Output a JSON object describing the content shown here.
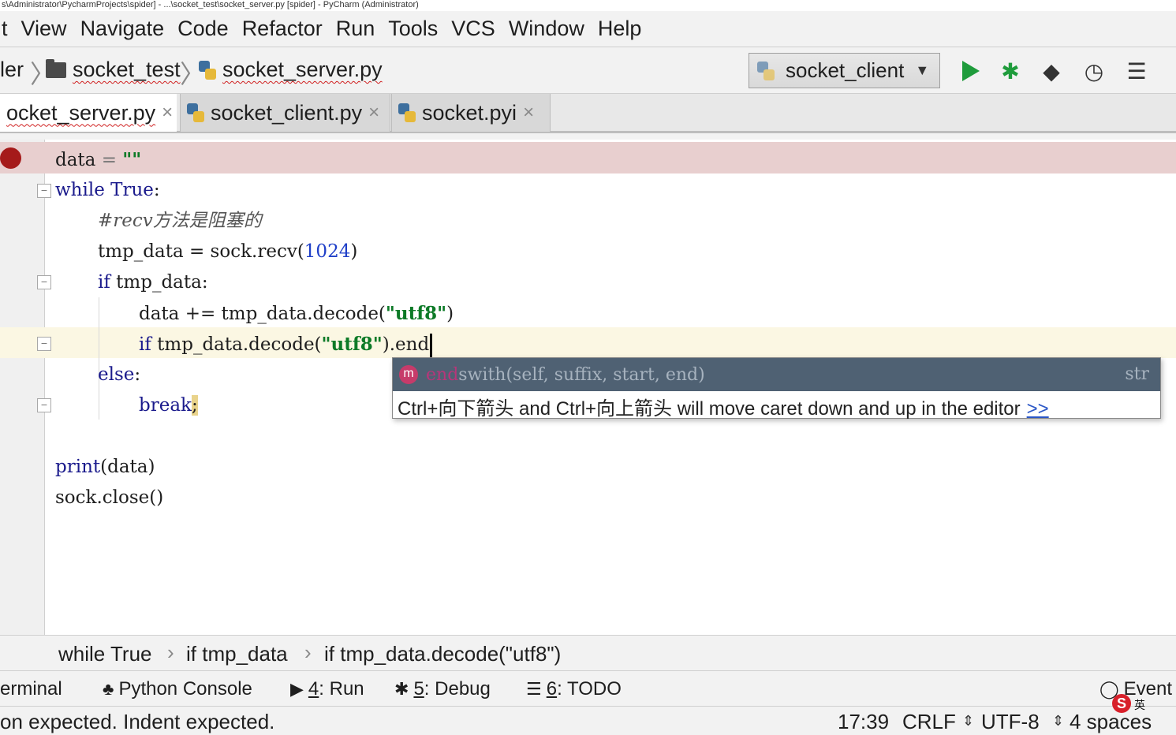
{
  "window": {
    "title": "s\\Administrator\\PycharmProjects\\spider] - ...\\socket_test\\socket_server.py [spider] - PyCharm (Administrator)"
  },
  "menu": [
    "t",
    "View",
    "Navigate",
    "Code",
    "Refactor",
    "Run",
    "Tools",
    "VCS",
    "Window",
    "Help"
  ],
  "nav": {
    "root": "ler",
    "folder": "socket_test",
    "file": "socket_server.py",
    "run_config": "socket_client"
  },
  "tabs": [
    {
      "label": "ocket_server.py",
      "active": true
    },
    {
      "label": "socket_client.py",
      "active": false
    },
    {
      "label": "socket.pyi",
      "active": false
    }
  ],
  "code": {
    "l1_a": "data",
    "l1_op": " = ",
    "l1_str": "\"\"",
    "l2_kw": "while",
    "l2_kw2": "True",
    "l2_c": ":",
    "l3": "#recv方法是阻塞的",
    "l4_a": "tmp_data = sock.recv(",
    "l4_num": "1024",
    "l4_b": ")",
    "l5_kw": "if",
    "l5_b": " tmp_data:",
    "l6_a": "data += tmp_data.decode(",
    "l6_str": "\"utf8\"",
    "l6_b": ")",
    "l7_kw": "if",
    "l7_a": " tmp_data.decode(",
    "l7_str": "\"utf8\"",
    "l7_b": ").end",
    "l8_kw": "else",
    "l8_c": ":",
    "l9_kw": "break",
    "l9_semi": ";",
    "l10_fn": "print",
    "l10_b": "(data)",
    "l11": "sock.close()"
  },
  "completion": {
    "icon_letter": "m",
    "match": "end",
    "rest": "swith(self, suffix, start, end)",
    "type": "str",
    "hint": "Ctrl+向下箭头 and Ctrl+向上箭头 will move caret down and up in the editor",
    "hint_link": ">>"
  },
  "code_breadcrumbs": [
    "while True",
    "if tmp_data",
    "if tmp_data.decode(\"utf8\")"
  ],
  "tool_windows": {
    "terminal": "erminal",
    "python_console": "Python Console",
    "run_num": "4",
    "run_label": ": Run",
    "debug_num": "5",
    "debug_label": ": Debug",
    "todo_num": "6",
    "todo_label": ": TODO",
    "event": "Event"
  },
  "status": {
    "message": "on expected. Indent expected.",
    "position": "17:39",
    "line_sep": "CRLF",
    "encoding": "UTF-8",
    "indent": "4 spaces"
  },
  "ime": {
    "logo": "S",
    "lang": "英"
  }
}
